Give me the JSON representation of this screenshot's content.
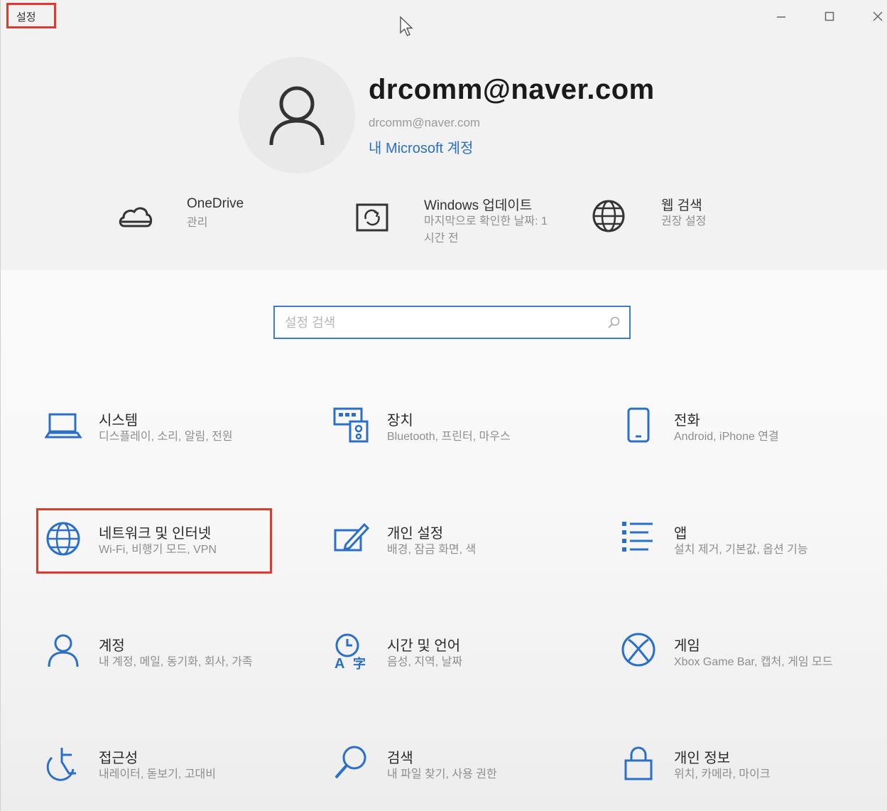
{
  "window": {
    "title": "설정",
    "minimize_icon": "minimize-icon",
    "maximize_icon": "maximize-icon",
    "close_icon": "close-icon"
  },
  "profile": {
    "name": "drcomm@naver.com",
    "email": "drcomm@naver.com",
    "account_link": "내 Microsoft 계정"
  },
  "quick_links": [
    {
      "title": "OneDrive",
      "subtitle": "관리",
      "icon": "cloud-icon"
    },
    {
      "title": "Windows 업데이트",
      "subtitle": "마지막으로 확인한 날짜: 1시간 전",
      "icon": "update-icon"
    },
    {
      "title": "웹 검색",
      "subtitle": "권장 설정",
      "icon": "globe-icon"
    }
  ],
  "search": {
    "placeholder": "설정 검색",
    "icon": "search-icon"
  },
  "categories": [
    {
      "title": "시스템",
      "subtitle": "디스플레이, 소리, 알림, 전원",
      "icon": "laptop-icon"
    },
    {
      "title": "장치",
      "subtitle": "Bluetooth, 프린터, 마우스",
      "icon": "devices-icon"
    },
    {
      "title": "전화",
      "subtitle": "Android, iPhone 연결",
      "icon": "phone-icon"
    },
    {
      "title": "네트워크 및 인터넷",
      "subtitle": "Wi-Fi, 비행기 모드, VPN",
      "icon": "network-globe-icon"
    },
    {
      "title": "개인 설정",
      "subtitle": "배경, 잠금 화면, 색",
      "icon": "personalization-icon"
    },
    {
      "title": "앱",
      "subtitle": "설치 제거, 기본값, 옵션 기능",
      "icon": "apps-icon"
    },
    {
      "title": "계정",
      "subtitle": "내 계정, 메일, 동기화, 회사, 가족",
      "icon": "person-icon"
    },
    {
      "title": "시간 및 언어",
      "subtitle": "음성, 지역, 날짜",
      "icon": "time-language-icon"
    },
    {
      "title": "게임",
      "subtitle": "Xbox Game Bar, 캡처, 게임 모드",
      "icon": "xbox-icon"
    },
    {
      "title": "접근성",
      "subtitle": "내레이터, 돋보기, 고대비",
      "icon": "accessibility-icon"
    },
    {
      "title": "검색",
      "subtitle": "내 파일 찾기, 사용 권한",
      "icon": "magnifier-icon"
    },
    {
      "title": "개인 정보",
      "subtitle": "위치, 카메라, 마이크",
      "icon": "lock-icon"
    }
  ],
  "colors": {
    "accent": "#2a6fc9",
    "highlight": "#e03a2e"
  }
}
